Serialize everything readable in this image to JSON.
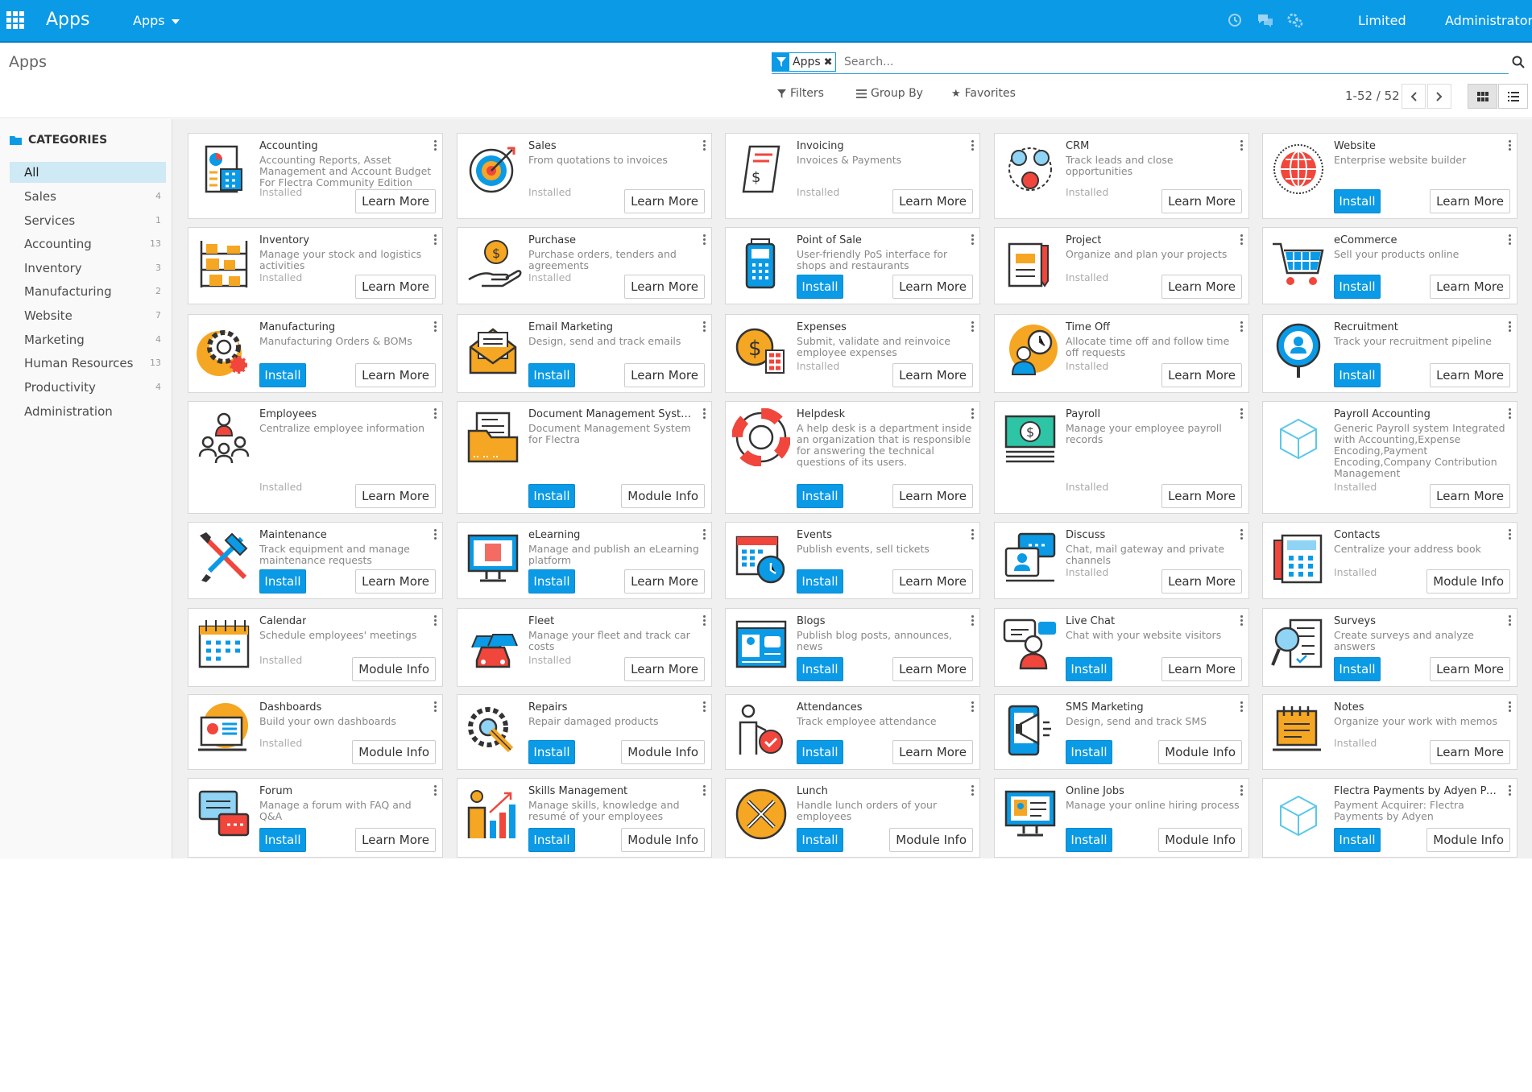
{
  "navbar": {
    "brand": "Apps",
    "menu": "Apps",
    "company": "Limited",
    "user": "Administrator",
    "color": "#0a9ae6"
  },
  "control_panel": {
    "breadcrumb": "Apps",
    "facet_label": "Apps",
    "search_placeholder": "Search...",
    "filters": "Filters",
    "group_by": "Group By",
    "favorites": "Favorites",
    "pager": "1-52 / 52"
  },
  "sidebar": {
    "heading": "CATEGORIES",
    "items": [
      {
        "label": "All",
        "count": ""
      },
      {
        "label": "Sales",
        "count": "4"
      },
      {
        "label": "Services",
        "count": "1"
      },
      {
        "label": "Accounting",
        "count": "13"
      },
      {
        "label": "Inventory",
        "count": "3"
      },
      {
        "label": "Manufacturing",
        "count": "2"
      },
      {
        "label": "Website",
        "count": "7"
      },
      {
        "label": "Marketing",
        "count": "4"
      },
      {
        "label": "Human Resources",
        "count": "13"
      },
      {
        "label": "Productivity",
        "count": "4"
      },
      {
        "label": "Administration",
        "count": ""
      }
    ]
  },
  "labels": {
    "installed": "Installed",
    "install": "Install",
    "learn_more": "Learn More",
    "module_info": "Module Info"
  },
  "apps": [
    {
      "name": "Accounting",
      "desc": "Accounting Reports, Asset Management and Account Budget For Flectra Community Edition",
      "installed": true,
      "button": "Learn More",
      "icon": "accounting-icon"
    },
    {
      "name": "Sales",
      "desc": "From quotations to invoices",
      "installed": true,
      "button": "Learn More",
      "icon": "target-icon"
    },
    {
      "name": "Invoicing",
      "desc": "Invoices & Payments",
      "installed": true,
      "button": "Learn More",
      "icon": "invoice-icon"
    },
    {
      "name": "CRM",
      "desc": "Track leads and close opportunities",
      "installed": true,
      "button": "Learn More",
      "icon": "crm-icon"
    },
    {
      "name": "Website",
      "desc": "Enterprise website builder",
      "installed": false,
      "button": "Learn More",
      "icon": "globe-icon"
    },
    {
      "name": "Inventory",
      "desc": "Manage your stock and logistics activities",
      "installed": true,
      "button": "Learn More",
      "icon": "shelves-icon"
    },
    {
      "name": "Purchase",
      "desc": "Purchase orders, tenders and agreements",
      "installed": true,
      "button": "Learn More",
      "icon": "purchase-icon"
    },
    {
      "name": "Point of Sale",
      "desc": "User-friendly PoS interface for shops and restaurants",
      "installed": false,
      "button": "Learn More",
      "icon": "pos-terminal-icon"
    },
    {
      "name": "Project",
      "desc": "Organize and plan your projects",
      "installed": true,
      "button": "Learn More",
      "icon": "project-icon"
    },
    {
      "name": "eCommerce",
      "desc": "Sell your products online",
      "installed": false,
      "button": "Learn More",
      "icon": "cart-icon"
    },
    {
      "name": "Manufacturing",
      "desc": "Manufacturing Orders & BOMs",
      "installed": false,
      "button": "Learn More",
      "icon": "gear-icon"
    },
    {
      "name": "Email Marketing",
      "desc": "Design, send and track emails",
      "installed": false,
      "button": "Learn More",
      "icon": "envelope-icon"
    },
    {
      "name": "Expenses",
      "desc": "Submit, validate and reinvoice employee expenses",
      "installed": true,
      "button": "Learn More",
      "icon": "expenses-icon"
    },
    {
      "name": "Time Off",
      "desc": "Allocate time off and follow time off requests",
      "installed": true,
      "button": "Learn More",
      "icon": "timeoff-icon"
    },
    {
      "name": "Recruitment",
      "desc": "Track your recruitment pipeline",
      "installed": false,
      "button": "Learn More",
      "icon": "recruitment-icon"
    },
    {
      "name": "Employees",
      "desc": "Centralize employee information",
      "installed": true,
      "button": "Learn More",
      "icon": "employees-icon"
    },
    {
      "name": "Document Management System",
      "desc": "Document Management System for Flectra",
      "installed": false,
      "button": "Module Info",
      "icon": "folder-icon"
    },
    {
      "name": "Helpdesk",
      "desc": "A help desk is a department inside an organization that is responsible for answering the technical questions of its users.",
      "installed": false,
      "button": "Learn More",
      "icon": "lifebuoy-icon"
    },
    {
      "name": "Payroll",
      "desc": "Manage your employee payroll records",
      "installed": true,
      "button": "Learn More",
      "icon": "payroll-icon"
    },
    {
      "name": "Payroll Accounting",
      "desc": "Generic Payroll system Integrated with Accounting,Expense Encoding,Payment Encoding,Company Contribution Management",
      "installed": true,
      "button": "Learn More",
      "icon": "cube-icon"
    },
    {
      "name": "Maintenance",
      "desc": "Track equipment and manage maintenance requests",
      "installed": false,
      "button": "Learn More",
      "icon": "tools-icon"
    },
    {
      "name": "eLearning",
      "desc": "Manage and publish an eLearning platform",
      "installed": false,
      "button": "Learn More",
      "icon": "monitor-icon"
    },
    {
      "name": "Events",
      "desc": "Publish events, sell tickets",
      "installed": false,
      "button": "Learn More",
      "icon": "calendar-clock-icon"
    },
    {
      "name": "Discuss",
      "desc": "Chat, mail gateway and private channels",
      "installed": true,
      "button": "Learn More",
      "icon": "discuss-icon"
    },
    {
      "name": "Contacts",
      "desc": "Centralize your address book",
      "installed": true,
      "button": "Module Info",
      "icon": "contacts-icon"
    },
    {
      "name": "Calendar",
      "desc": "Schedule employees' meetings",
      "installed": true,
      "button": "Module Info",
      "icon": "calendar-icon"
    },
    {
      "name": "Fleet",
      "desc": "Manage your fleet and track car costs",
      "installed": true,
      "button": "Learn More",
      "icon": "car-icon"
    },
    {
      "name": "Blogs",
      "desc": "Publish blog posts, announces, news",
      "installed": false,
      "button": "Learn More",
      "icon": "blog-icon"
    },
    {
      "name": "Live Chat",
      "desc": "Chat with your website visitors",
      "installed": false,
      "button": "Learn More",
      "icon": "livechat-icon"
    },
    {
      "name": "Surveys",
      "desc": "Create surveys and analyze answers",
      "installed": false,
      "button": "Learn More",
      "icon": "survey-icon"
    },
    {
      "name": "Dashboards",
      "desc": "Build your own dashboards",
      "installed": true,
      "button": "Module Info",
      "icon": "dashboard-icon"
    },
    {
      "name": "Repairs",
      "desc": "Repair damaged products",
      "installed": false,
      "button": "Module Info",
      "icon": "repair-icon"
    },
    {
      "name": "Attendances",
      "desc": "Track employee attendance",
      "installed": false,
      "button": "Learn More",
      "icon": "attendance-icon"
    },
    {
      "name": "SMS Marketing",
      "desc": "Design, send and track SMS",
      "installed": false,
      "button": "Module Info",
      "icon": "sms-icon"
    },
    {
      "name": "Notes",
      "desc": "Organize your work with memos",
      "installed": true,
      "button": "Learn More",
      "icon": "notes-icon"
    },
    {
      "name": "Forum",
      "desc": "Manage a forum with FAQ and Q&A",
      "installed": false,
      "button": "Learn More",
      "icon": "forum-icon"
    },
    {
      "name": "Skills Management",
      "desc": "Manage skills, knowledge and resumé of your employees",
      "installed": false,
      "button": "Module Info",
      "icon": "skills-icon"
    },
    {
      "name": "Lunch",
      "desc": "Handle lunch orders of your employees",
      "installed": false,
      "button": "Module Info",
      "icon": "lunch-icon"
    },
    {
      "name": "Online Jobs",
      "desc": "Manage your online hiring process",
      "installed": false,
      "button": "Module Info",
      "icon": "jobs-icon"
    },
    {
      "name": "Flectra Payments by Adyen Pay...",
      "desc": "Payment Acquirer: Flectra Payments by Adyen",
      "installed": false,
      "button": "Module Info",
      "icon": "cube-icon"
    }
  ]
}
